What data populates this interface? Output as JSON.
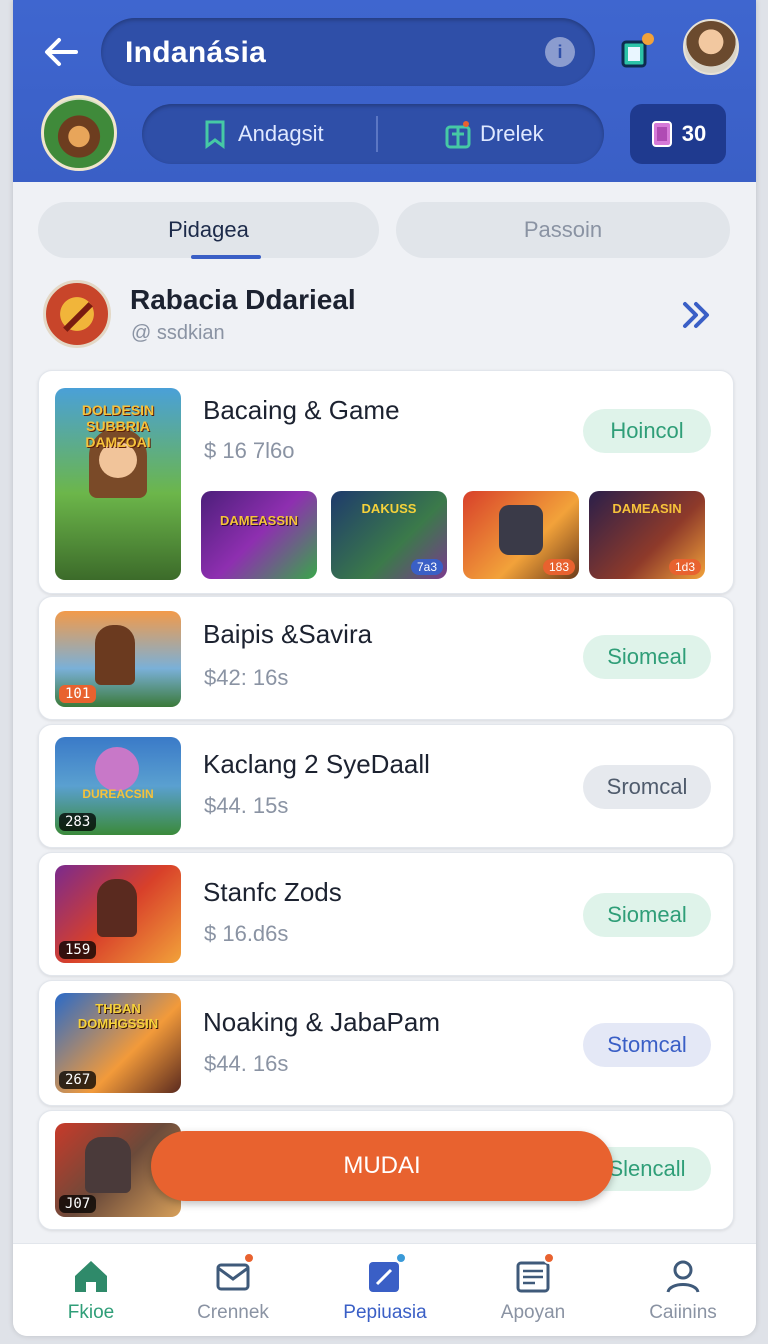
{
  "header": {
    "title": "Indanásia",
    "filters": [
      {
        "label": "Andagsit",
        "icon": "bookmark-icon"
      },
      {
        "label": "Drelek",
        "icon": "gift-icon"
      }
    ],
    "coin_count": "30"
  },
  "tabs": [
    {
      "label": "Pidagea",
      "active": true
    },
    {
      "label": "Passoin",
      "active": false
    }
  ],
  "section": {
    "title": "Rabacia Ddarieal",
    "handle": "@ ssdkian"
  },
  "cards": [
    {
      "name": "Bacaing & Game",
      "price": "$ 16 7l6o",
      "button": "Hoincol",
      "button_style": "green",
      "thumb_text": "DOLDESIN SUBBRIA DAMZOAI",
      "minis": [
        {
          "text": "DAMEASSIN",
          "badge": ""
        },
        {
          "text": "DAKUSS",
          "badge": "7a3"
        },
        {
          "text": "",
          "badge": "183"
        },
        {
          "text": "DAMEASIN",
          "badge": "1d3"
        }
      ]
    },
    {
      "name": "Baipis &Savira",
      "price": "$42: 16s",
      "button": "Siomeal",
      "button_style": "green",
      "badge": "101"
    },
    {
      "name": "Kaclang 2 SyeDaall",
      "price": "$44. 15s",
      "button": "Sromcal",
      "button_style": "gray",
      "badge": "283",
      "thumb_text": "DUREACSIN"
    },
    {
      "name": "Stanfc Zods",
      "price": "$ 16.d6s",
      "button": "Siomeal",
      "button_style": "green",
      "badge": "159"
    },
    {
      "name": "Noaking & JabaPam",
      "price": "$44. 16s",
      "button": "Stomcal",
      "button_style": "blue",
      "badge": "267",
      "thumb_text": "THBAN DOMHGSSIN"
    },
    {
      "name": "",
      "price": "",
      "button": "Slencall",
      "button_style": "green",
      "badge": "J07"
    }
  ],
  "fab_label": "MUDAI",
  "bottom_nav": [
    {
      "label": "Fkioe",
      "icon": "home-icon",
      "active": false,
      "color": "#2f9e78"
    },
    {
      "label": "Crennek",
      "icon": "mail-icon",
      "active": false
    },
    {
      "label": "Pepiuasia",
      "icon": "edit-icon",
      "active": true
    },
    {
      "label": "Apoyan",
      "icon": "news-icon",
      "active": false
    },
    {
      "label": "Caiinins",
      "icon": "profile-icon",
      "active": false
    }
  ],
  "colors": {
    "primary": "#3f66cf",
    "accent": "#e8622f",
    "green": "#2f9e78"
  }
}
